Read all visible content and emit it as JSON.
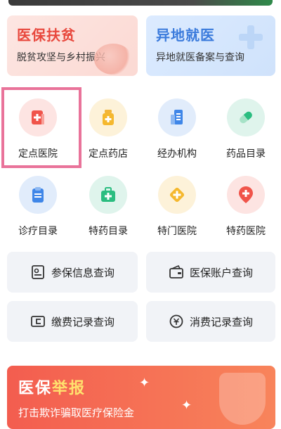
{
  "banners": {
    "left": {
      "title": "医保扶贫",
      "subtitle": "脱贫攻坚与乡村振兴"
    },
    "right": {
      "title": "异地就医",
      "subtitle": "异地就医备案与查询"
    }
  },
  "services": [
    {
      "label": "定点医院",
      "icon": "hospital-icon"
    },
    {
      "label": "定点药店",
      "icon": "pharmacy-icon"
    },
    {
      "label": "经办机构",
      "icon": "building-icon"
    },
    {
      "label": "药品目录",
      "icon": "capsule-icon"
    },
    {
      "label": "诊疗目录",
      "icon": "clipboard-icon"
    },
    {
      "label": "特药目录",
      "icon": "medkit-icon"
    },
    {
      "label": "特门医院",
      "icon": "diamond-cross-icon"
    },
    {
      "label": "特药医院",
      "icon": "map-pin-icon"
    }
  ],
  "queries": [
    {
      "label": "参保信息查询",
      "icon": "id-card-icon"
    },
    {
      "label": "医保账户查询",
      "icon": "wallet-icon"
    },
    {
      "label": "缴费记录查询",
      "icon": "payment-card-icon"
    },
    {
      "label": "消费记录查询",
      "icon": "yuan-coin-icon"
    }
  ],
  "promo": {
    "title_part1": "医保",
    "title_part2": "举报",
    "subtitle": "打击欺诈骗取医疗保险金"
  },
  "colors": {
    "primary_red": "#e8483d",
    "primary_blue": "#3b7bdc",
    "highlight_border": "#e9739a"
  }
}
